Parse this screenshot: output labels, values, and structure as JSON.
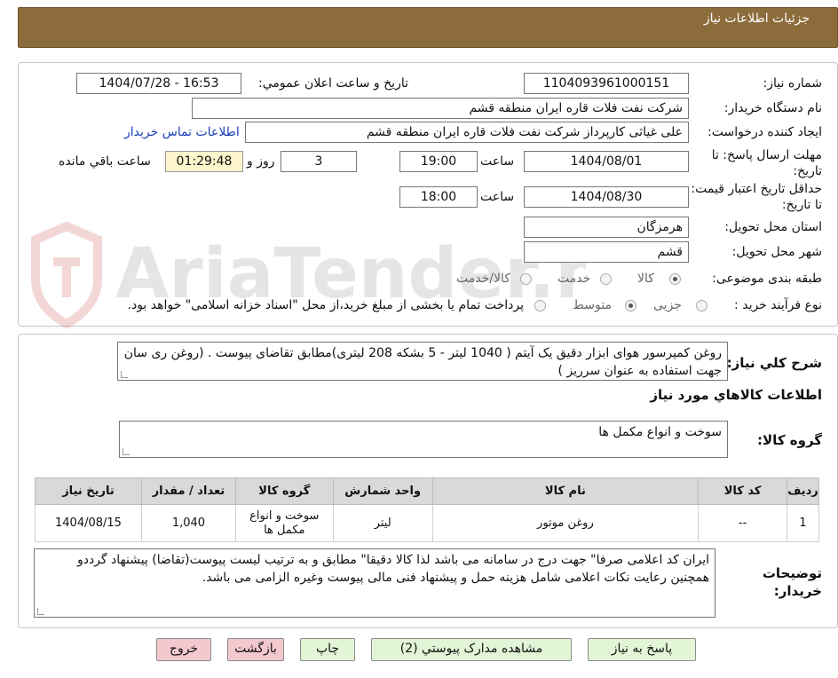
{
  "header": {
    "title": "جزئیات اطلاعات نیاز"
  },
  "details": {
    "need_number_label": "شماره نیاز:",
    "need_number": "1104093961000151",
    "announce_label": "تاریخ و ساعت اعلان عمومي:",
    "announce_value": "1404/07/28 - 16:53",
    "buyer_org_label": "نام دستگاه خریدار:",
    "buyer_org": "شرکت نفت فلات قاره ایران منطقه قشم",
    "requester_label": "ایجاد کننده درخواست:",
    "requester": "علی غیاثی کارپرداز شرکت نفت فلات قاره ایران منطقه قشم",
    "contact_link": "اطلاعات تماس خریدار",
    "deadline_label": "مهلت ارسال پاسخ: تا تاریخ:",
    "deadline_date": "1404/08/01",
    "time_label": "ساعت",
    "deadline_time": "19:00",
    "days_value": "3",
    "days_label": "روز و",
    "remaining_time": "01:29:48",
    "remaining_label": "ساعت باقي مانده",
    "validity_label": "حداقل تاریخ اعتبار قیمت: تا تاریخ:",
    "validity_date": "1404/08/30",
    "validity_time": "18:00",
    "province_label": "استان محل تحویل:",
    "province": "هرمزگان",
    "city_label": "شهر محل تحویل:",
    "city": "قشم",
    "category_label": "طبقه بندی موضوعی:",
    "category_options": [
      "کالا",
      "خدمت",
      "کالا/خدمت"
    ],
    "process_label": "نوع فرآیند خرید :",
    "process_options": [
      "جزیی",
      "متوسط"
    ],
    "process_note": "پرداخت تمام یا بخشی از مبلغ خرید،از محل \"اسناد خزانه اسلامی\" خواهد بود."
  },
  "summary": {
    "label": "شرح کلي نیاز:",
    "text": "روغن کمپرسور هوای ابزار دقیق یک آیتم ( 1040 لیتر - 5 بشکه 208 لیتری)مطابق تقاضای پیوست . (روغن ری سان جهت استفاده به عنوان سرریز )",
    "goods_info_title": "اطلاعات کالاهاي مورد نیاز",
    "goods_group_label": "گروه کالا:",
    "goods_group": "سوخت و انواع مکمل ها"
  },
  "table": {
    "headers": [
      "ردیف",
      "کد کالا",
      "نام کالا",
      "واحد شمارش",
      "گروه کالا",
      "تعداد / مقدار",
      "تاریخ نیاز"
    ],
    "rows": [
      [
        "1",
        "--",
        "روغن موتور",
        "لیتر",
        "سوخت و انواع مکمل ها",
        "1,040",
        "1404/08/15"
      ]
    ]
  },
  "notes": {
    "label": "توضیحات خریدار:",
    "text": "ایران کد اعلامی صرفا\" جهت درج در سامانه می باشد لذا  کالا دقیقا\" مطابق و به ترتیب لیست پیوست(تقاضا) پیشنهاد گرددو همچنین رعایت نکات اعلامی شامل هزینه حمل و پیشنهاد فنی مالی پیوست وغیره الزامی می باشد."
  },
  "buttons": {
    "reply": "پاسخ به نیاز",
    "attachments": "مشاهده مدارک پیوستي (2)",
    "print": "چاپ",
    "back": "بازگشت",
    "exit": "خروج"
  },
  "colors": {
    "header_bg": "#8c6c3a",
    "timer_bg": "#fdf6cc",
    "button_green": "#e2f5d6",
    "button_pink": "#f4c8cf"
  },
  "watermark": "AriaTender.neT"
}
